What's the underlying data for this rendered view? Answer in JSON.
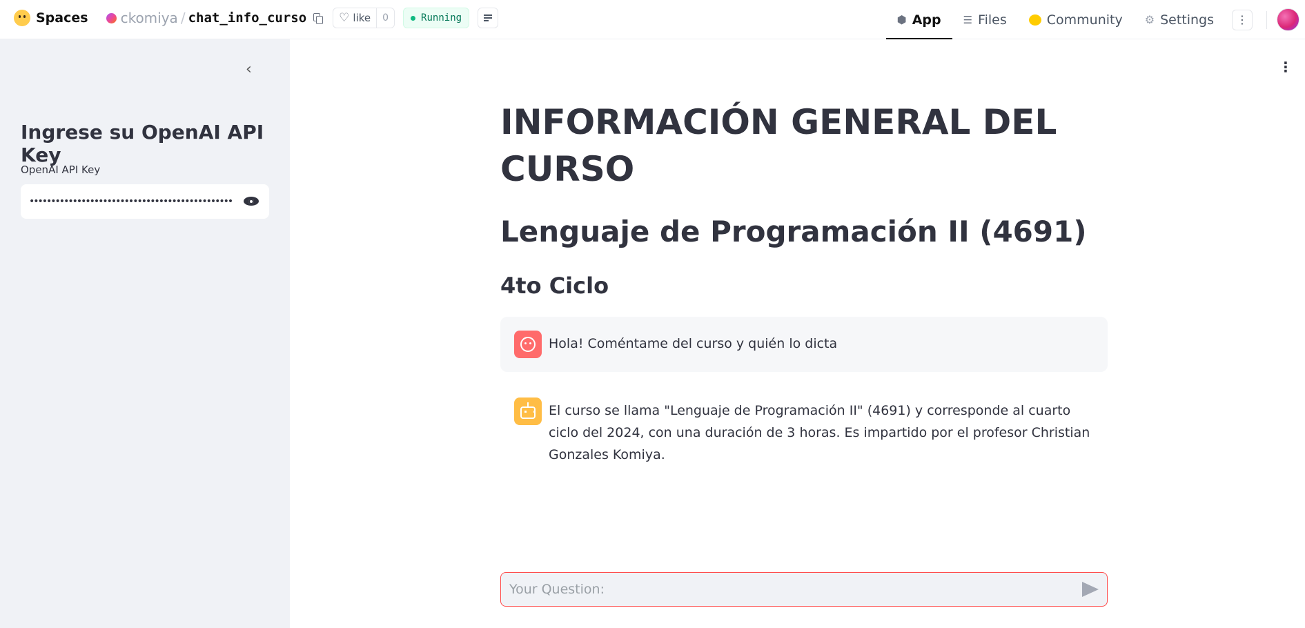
{
  "header": {
    "brand": "Spaces",
    "owner": "ckomiya",
    "separator": "/",
    "repo": "chat_info_curso",
    "like_label": "like",
    "like_count": "0",
    "status": "Running",
    "tabs": [
      {
        "label": "App",
        "icon": "cube-icon",
        "active": true
      },
      {
        "label": "Files",
        "icon": "files-icon",
        "active": false
      },
      {
        "label": "Community",
        "icon": "community-icon",
        "active": false
      },
      {
        "label": "Settings",
        "icon": "gear-icon",
        "active": false
      }
    ],
    "kebab": "⋮"
  },
  "sidebar": {
    "collapse_glyph": "‹",
    "title": "Ingrese su OpenAI API Key",
    "key_label": "OpenAI API Key",
    "key_value": "•••••••••••••••••••••••••••••••••••••••••••••••••••"
  },
  "main": {
    "menu_glyph": "⋮",
    "title": "INFORMACIÓN GENERAL DEL CURSO",
    "subtitle": "Lenguaje de Programación II (4691)",
    "subheading": "4to Ciclo",
    "messages": [
      {
        "role": "user",
        "text": "Hola! Coméntame del curso y quién lo dicta"
      },
      {
        "role": "assistant",
        "text": "El curso se llama \"Lenguaje de Programación II\" (4691) y corresponde al cuarto ciclo del 2024, con una duración de 3 horas. Es impartido por el profesor Christian Gonzales Komiya."
      }
    ],
    "chat_placeholder": "Your Question:"
  },
  "colors": {
    "accent": "#ff4b4b",
    "sidebar_bg": "#f0f2f6",
    "status_green": "#10b981",
    "user_avatar": "#ff6b6b",
    "bot_avatar": "#ffbd45"
  }
}
